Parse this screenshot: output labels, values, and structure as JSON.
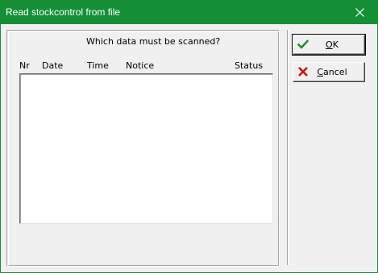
{
  "window": {
    "title": "Read stockcontrol from file"
  },
  "panel": {
    "question": "Which data must be scanned?",
    "columns": [
      "Nr",
      "Date",
      "Time",
      "Notice",
      "Status"
    ]
  },
  "buttons": {
    "ok_label": "OK",
    "cancel_label": "Cancel"
  },
  "colors": {
    "titlebar": "#148f36",
    "ok_check": "#1a8a2a",
    "cancel_x": "#d01010"
  },
  "icons": {
    "ok": "checkmark-icon",
    "cancel": "x-icon",
    "close": "close-icon"
  }
}
